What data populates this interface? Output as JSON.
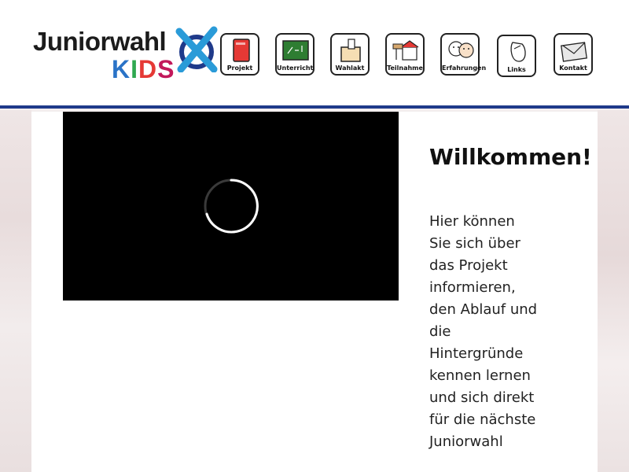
{
  "header": {
    "logo": {
      "main_text": "Juniorwahl",
      "kids_letters": [
        "K",
        "I",
        "D",
        "S"
      ]
    },
    "nav": [
      {
        "label": "Projekt",
        "icon": "red-book-icon"
      },
      {
        "label": "Unterricht",
        "icon": "chalkboard-icon"
      },
      {
        "label": "Wahlakt",
        "icon": "ballot-box-icon"
      },
      {
        "label": "Teilnahme",
        "icon": "school-building-icon"
      },
      {
        "label": "Erfahrungen",
        "icon": "faces-speech-icon"
      },
      {
        "label": "Links",
        "icon": "computer-mouse-icon"
      },
      {
        "label": "Kontakt",
        "icon": "envelope-icon"
      }
    ]
  },
  "main": {
    "video": {
      "state": "loading",
      "icon": "loading-spinner-icon"
    },
    "welcome": {
      "title": "Willkommen!",
      "text": "Hier können Sie sich über das Projekt informieren, den Ablauf und die Hintergründe kennen lernen und sich direkt für die nächste Juniorwahl"
    }
  },
  "colors": {
    "header_border": "#1f3a8a",
    "logo_x_blue": "#2a9bd8",
    "logo_x_dark": "#1f3a8a"
  }
}
